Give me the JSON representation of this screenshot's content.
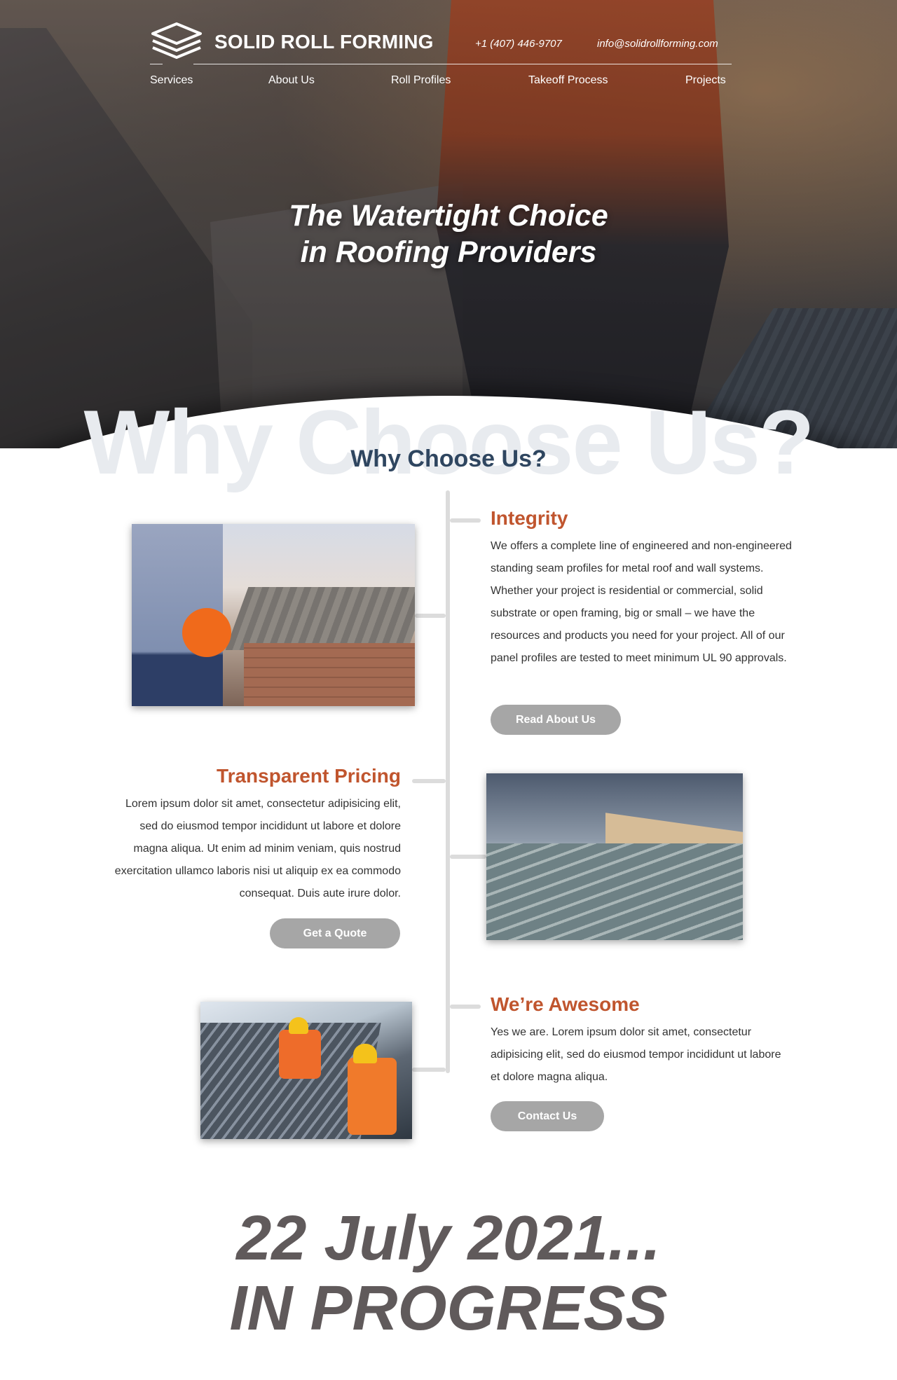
{
  "brand": {
    "name": "SOLID ROLL FORMING",
    "logo_icon": "stacked-layers-icon"
  },
  "contact": {
    "phone": "+1 (407) 446-9707",
    "email": "info@solidrollforming.com"
  },
  "nav": [
    {
      "label": "Services"
    },
    {
      "label": "About Us"
    },
    {
      "label": "Roll Profiles"
    },
    {
      "label": "Takeoff Process"
    },
    {
      "label": "Projects"
    }
  ],
  "hero": {
    "line1": "The Watertight Choice",
    "line2": "in Roofing Providers"
  },
  "why": {
    "bg_word": "Why Choose Us?",
    "title": "Why Choose Us?"
  },
  "items": [
    {
      "title": "Integrity",
      "text": "We offers a complete line of engineered and non-engineered standing seam profiles for metal roof and wall systems. Whether your project is residential or commercial, solid substrate or open framing, big or small – we have the resources and products you need for your project. All of our panel profiles are tested to meet minimum UL 90 approvals.",
      "button": "Read About Us"
    },
    {
      "title": "Transparent Pricing",
      "text": "Lorem ipsum dolor sit amet, consectetur adipisicing elit, sed do eiusmod tempor incididunt ut labore et dolore magna aliqua. Ut enim ad minim veniam, quis nostrud exercitation ullamco laboris nisi ut aliquip ex ea commodo consequat. Duis aute irure dolor.",
      "button": "Get a Quote"
    },
    {
      "title": "We’re Awesome",
      "text": "Yes we are. Lorem ipsum dolor sit amet, consectetur adipisicing elit, sed do eiusmod tempor incididunt ut labore et dolore magna aliqua.",
      "button": "Contact Us"
    }
  ],
  "status": {
    "line1": "22 July 2021...",
    "line2": "IN PROGRESS"
  },
  "colors": {
    "accent": "#c0552e",
    "heading": "#2f4660",
    "button": "#a6a6a6",
    "status": "#605a5b"
  }
}
